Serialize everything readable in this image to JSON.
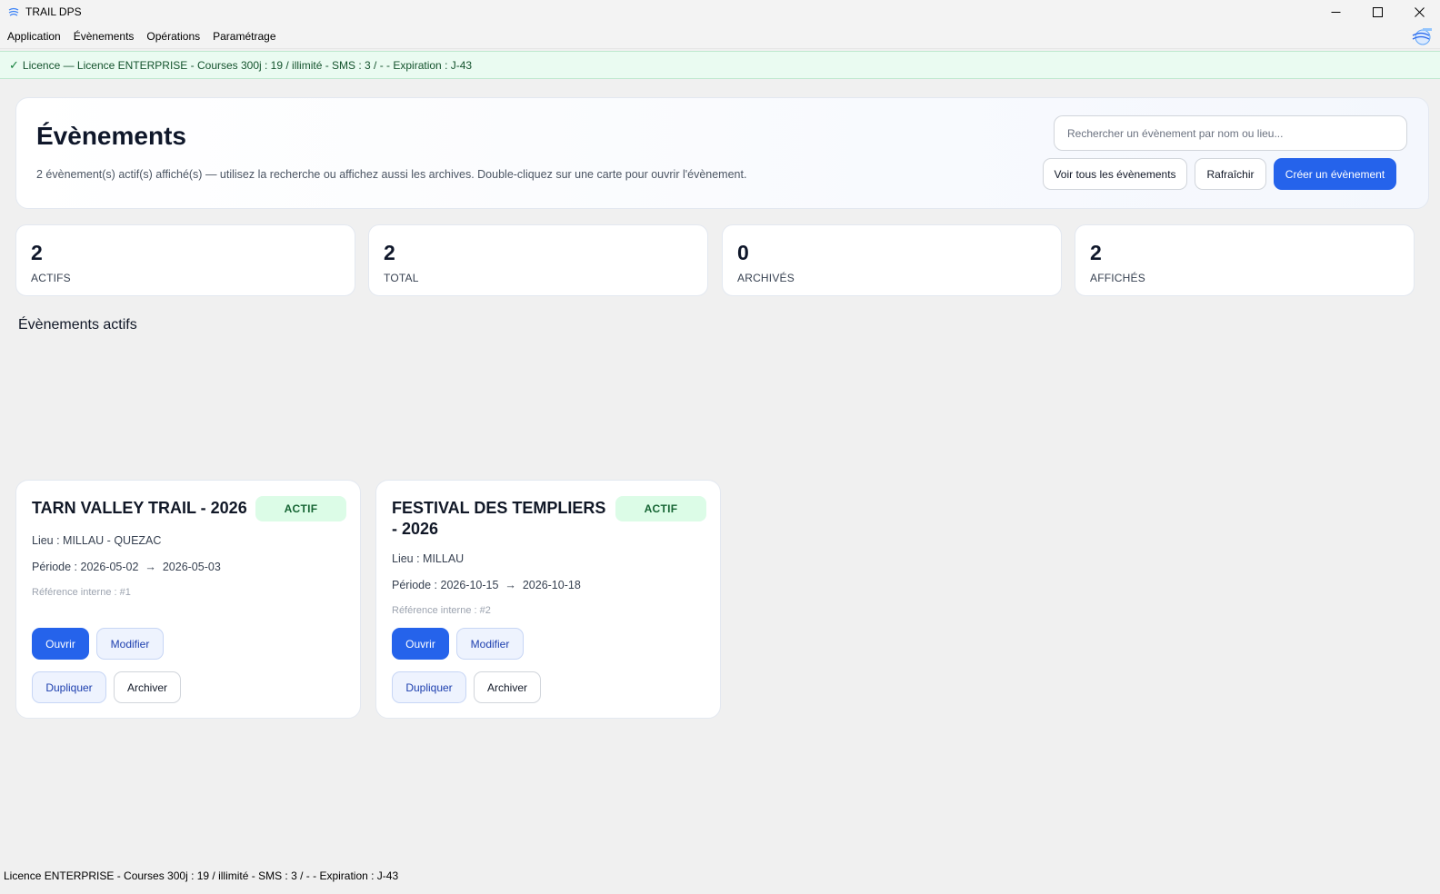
{
  "window": {
    "title": "TRAIL DPS"
  },
  "menu": {
    "items": [
      "Application",
      "Évènements",
      "Opérations",
      "Paramétrage"
    ]
  },
  "license_banner": {
    "text": "Licence — Licence ENTERPRISE - Courses 300j : 19 / illimité - SMS : 3 / - - Expiration : J-43"
  },
  "header": {
    "title": "Évènements",
    "subtitle": "2 évènement(s) actif(s) affiché(s) — utilisez la recherche ou affichez aussi les archives. Double-cliquez sur une carte pour ouvrir l'évènement.",
    "search_placeholder": "Rechercher un évènement par nom ou lieu...",
    "search_value": "",
    "buttons": {
      "show_all": "Voir tous les évènements",
      "refresh": "Rafraîchir",
      "create": "Créer un évènement"
    }
  },
  "stats": [
    {
      "value": "2",
      "label": "ACTIFS"
    },
    {
      "value": "2",
      "label": "TOTAL"
    },
    {
      "value": "0",
      "label": "ARCHIVÉS"
    },
    {
      "value": "2",
      "label": "AFFICHÉS"
    }
  ],
  "section": {
    "title": "Évènements actifs"
  },
  "events": [
    {
      "title": "TARN VALLEY TRAIL - 2026",
      "status": "ACTIF",
      "location": "Lieu : MILLAU - QUEZAC",
      "period": "Période : 2026-05-02  →  2026-05-03",
      "reference": "Référence interne : #1",
      "actions": {
        "open": "Ouvrir",
        "edit": "Modifier",
        "duplicate": "Dupliquer",
        "archive": "Archiver"
      }
    },
    {
      "title": "FESTIVAL DES TEMPLIERS - 2026",
      "status": "ACTIF",
      "location": "Lieu : MILLAU",
      "period": "Période : 2026-10-15  →  2026-10-18",
      "reference": "Référence interne : #2",
      "actions": {
        "open": "Ouvrir",
        "edit": "Modifier",
        "duplicate": "Dupliquer",
        "archive": "Archiver"
      }
    }
  ],
  "status_bar": {
    "text": "Licence ENTERPRISE - Courses 300j : 19 / illimité - SMS : 3 / - - Expiration : J-43"
  },
  "colors": {
    "primary": "#2563eb",
    "success_bg": "#dcfce7",
    "success_text": "#166534",
    "license_bg": "#eafbf1"
  }
}
